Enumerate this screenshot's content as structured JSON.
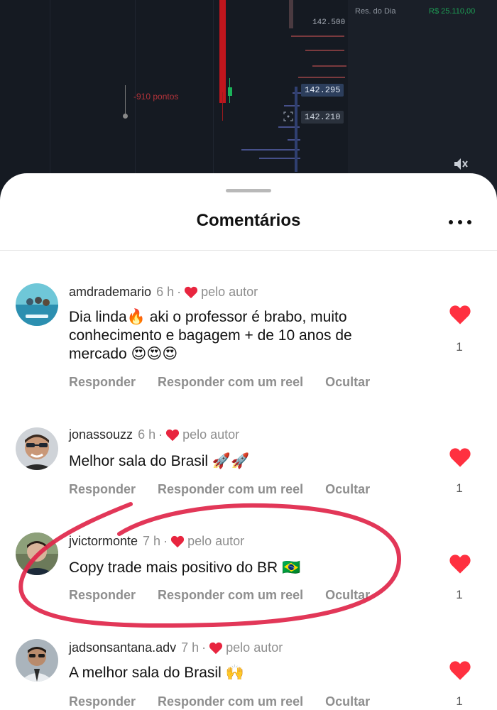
{
  "chart": {
    "pts_label": "-910 pontos",
    "price_top": "142.500",
    "price_blue1": "142.295",
    "price_tag2": "142.210",
    "res_label": "Res. do Dia",
    "res_value": "R$ 25.110,00",
    "colors": {
      "sell": "#c0161d",
      "buy": "#1bb35a",
      "result_positive": "#1e9e55"
    }
  },
  "sheet": {
    "title": "Comentários",
    "more_icon": "more-horizontal-icon",
    "comments": [
      {
        "user": "amdrademario",
        "time": "6 h",
        "liked_by_author": "pelo autor",
        "text": "Dia linda🔥 aki o professor é brabo, muito conhecimento e bagagem + de 10 anos de mercado 😍😍😍",
        "actions": [
          "Responder",
          "Responder com um reel",
          "Ocultar"
        ],
        "likes": "1"
      },
      {
        "user": "jonassouzz",
        "time": "6 h",
        "liked_by_author": "pelo autor",
        "text": "Melhor sala do Brasil 🚀🚀",
        "actions": [
          "Responder",
          "Responder com um reel",
          "Ocultar"
        ],
        "likes": "1"
      },
      {
        "user": "jvictormonte",
        "time": "7 h",
        "liked_by_author": "pelo autor",
        "text": "Copy trade mais positivo do BR 🇧🇷",
        "actions": [
          "Responder",
          "Responder com um reel",
          "Ocultar"
        ],
        "likes": "1"
      },
      {
        "user": "jadsonsantana.adv",
        "time": "7 h",
        "liked_by_author": "pelo autor",
        "text": "A melhor sala do Brasil 🙌",
        "actions": [
          "Responder",
          "Responder com um reel",
          "Ocultar"
        ],
        "likes": "1"
      }
    ],
    "heart_color": "#ff3040",
    "highlight_color": "#e0264a"
  }
}
